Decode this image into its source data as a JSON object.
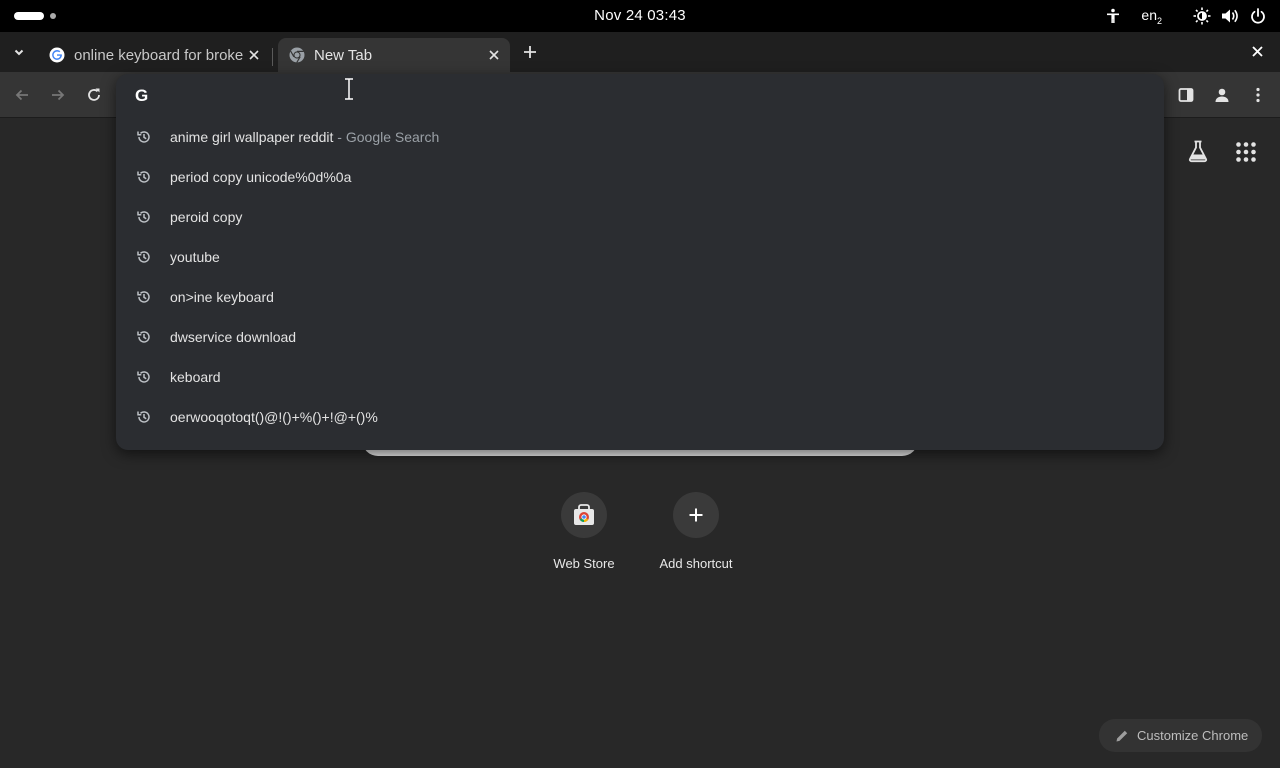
{
  "system_bar": {
    "clock": "Nov 24  03:43",
    "language": "en",
    "language_sub": "2",
    "icons": [
      "accessibility-icon",
      "brightness-icon",
      "volume-icon",
      "power-icon"
    ]
  },
  "tabs": [
    {
      "title": "online keyboard for broken keyboard",
      "icon": "google-favicon",
      "active": false
    },
    {
      "title": "New Tab",
      "icon": "chrome-favicon",
      "active": true
    }
  ],
  "omnibox": {
    "input_value": "",
    "logo": "G",
    "suggestions": [
      {
        "text": "anime girl wallpaper reddit",
        "description": " - Google Search"
      },
      {
        "text": "period copy unicode%0d%0a",
        "description": ""
      },
      {
        "text": "peroid copy",
        "description": ""
      },
      {
        "text": "youtube",
        "description": ""
      },
      {
        "text": "on>ine keyboard",
        "description": ""
      },
      {
        "text": "dwservice download",
        "description": ""
      },
      {
        "text": "keboard",
        "description": ""
      },
      {
        "text": "oerwooqotoqt()@!()+%()+!@+()%",
        "description": ""
      }
    ]
  },
  "ntp": {
    "shortcuts": [
      {
        "label": "Web Store",
        "icon": "web-store-icon"
      },
      {
        "label": "Add shortcut",
        "icon": "plus-icon"
      }
    ],
    "customize_label": "Customize Chrome"
  },
  "colors": {
    "page_bg": "#282828",
    "dropdown_bg": "#2b2d31",
    "topbar_bg": "#000000",
    "tabstrip_bg": "#1f1f1f",
    "toolbar_bg": "#353535"
  }
}
